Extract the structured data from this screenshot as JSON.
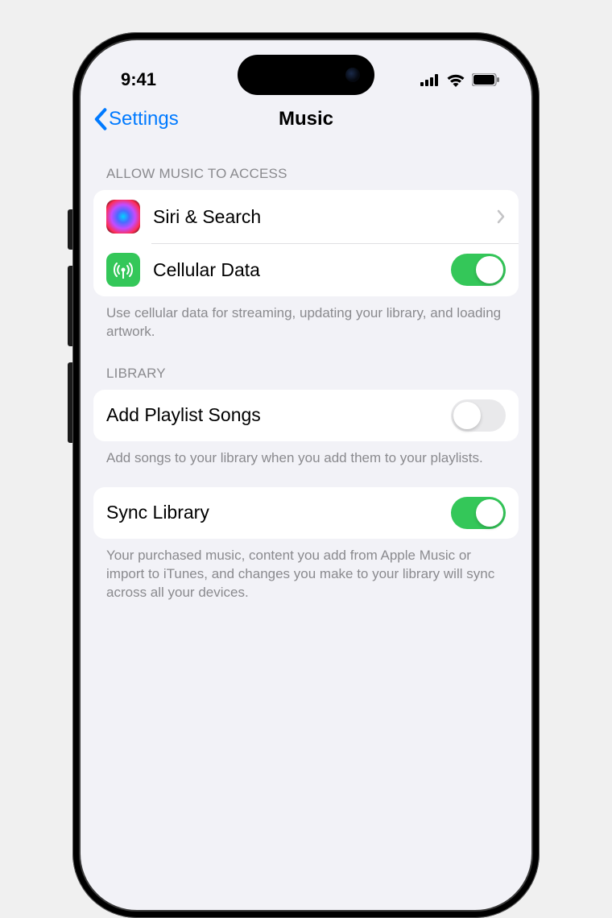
{
  "status": {
    "time": "9:41"
  },
  "nav": {
    "back_label": "Settings",
    "title": "Music"
  },
  "sections": {
    "access": {
      "header": "Allow Music to Access",
      "items": {
        "siri": {
          "label": "Siri & Search"
        },
        "cellular": {
          "label": "Cellular Data",
          "toggle": true
        }
      },
      "footer": "Use cellular data for streaming, updating your library, and loading artwork."
    },
    "library": {
      "header": "Library",
      "add_playlist": {
        "label": "Add Playlist Songs",
        "toggle": false
      },
      "add_playlist_footer": "Add songs to your library when you add them to your playlists.",
      "sync": {
        "label": "Sync Library",
        "toggle": true
      },
      "sync_footer": "Your purchased music, content you add from Apple Music or import to iTunes, and changes you make to your library will sync across all your devices."
    }
  }
}
